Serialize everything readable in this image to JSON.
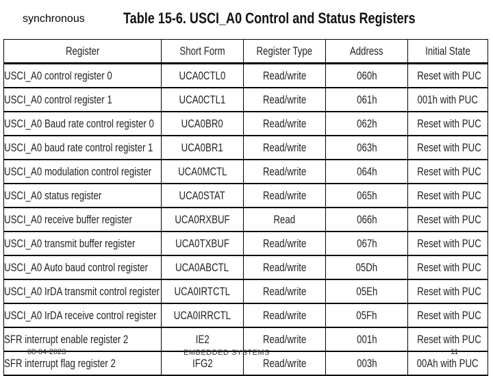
{
  "slide": {
    "label": "synchronous",
    "table_title": "Table 15-6. USCI_A0 Control and Status Registers"
  },
  "table": {
    "headers": [
      "Register",
      "Short Form",
      "Register Type",
      "Address",
      "Initial State"
    ],
    "rows": [
      [
        "USCI_A0 control register 0",
        "UCA0CTL0",
        "Read/write",
        "060h",
        "Reset with PUC"
      ],
      [
        "USCI_A0 control register 1",
        "UCA0CTL1",
        "Read/write",
        "061h",
        "001h with PUC"
      ],
      [
        "USCI_A0 Baud rate control register 0",
        "UCA0BR0",
        "Read/write",
        "062h",
        "Reset with PUC"
      ],
      [
        "USCI_A0 baud rate control register 1",
        "UCA0BR1",
        "Read/write",
        "063h",
        "Reset with PUC"
      ],
      [
        "USCI_A0 modulation control register",
        "UCA0MCTL",
        "Read/write",
        "064h",
        "Reset with PUC"
      ],
      [
        "USCI_A0 status register",
        "UCA0STAT",
        "Read/write",
        "065h",
        "Reset with PUC"
      ],
      [
        "USCI_A0 receive buffer register",
        "UCA0RXBUF",
        "Read",
        "066h",
        "Reset with PUC"
      ],
      [
        "USCI_A0 transmit buffer register",
        "UCA0TXBUF",
        "Read/write",
        "067h",
        "Reset with PUC"
      ],
      [
        "USCI_A0 Auto baud control register",
        "UCA0ABCTL",
        "Read/write",
        "05Dh",
        "Reset with PUC"
      ],
      [
        "USCI_A0 IrDA transmit control register",
        "UCA0IRTCTL",
        "Read/write",
        "05Eh",
        "Reset with PUC"
      ],
      [
        "USCI_A0 IrDA receive control register",
        "UCA0IRRCTL",
        "Read/write",
        "05Fh",
        "Reset with PUC"
      ],
      [
        "SFR interrupt enable register 2",
        "IE2",
        "Read/write",
        "001h",
        "Reset with PUC"
      ],
      [
        "SFR interrupt flag register 2",
        "IFG2",
        "Read/write",
        "003h",
        "00Ah with PUC"
      ]
    ]
  },
  "footer": {
    "date": "08-04-2023",
    "title": "EMBEDDED SYSTEMS",
    "page": "11"
  }
}
